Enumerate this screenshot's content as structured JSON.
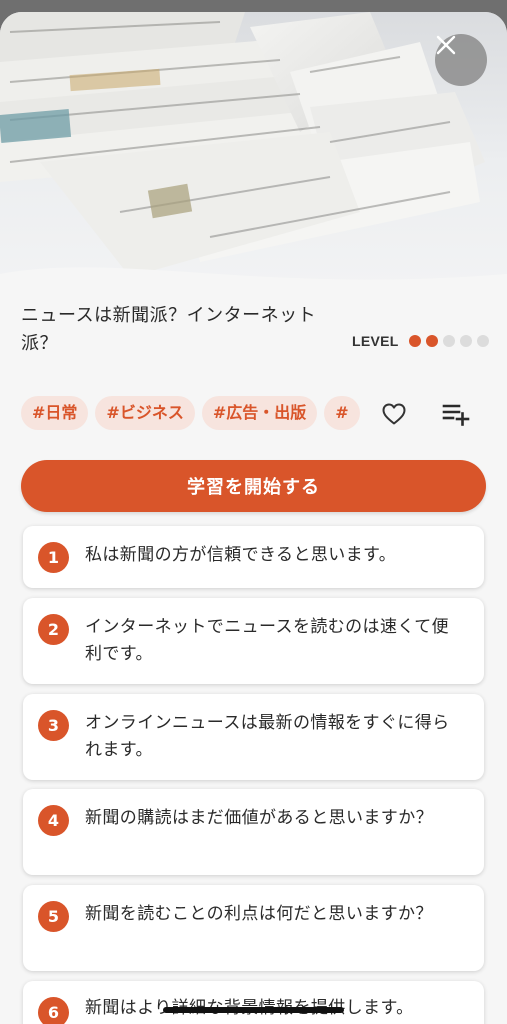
{
  "close_icon": "close-icon",
  "header": {
    "title": "ニュースは新聞派？インターネット派？",
    "level_label": "LEVEL",
    "level": {
      "value": 2,
      "max": 5
    },
    "accent_color": "#d9552a"
  },
  "tags": [
    "#日常",
    "#ビジネス",
    "#広告・出版",
    "#"
  ],
  "actions": {
    "favorite_icon": "heart-icon",
    "add_to_list_icon": "playlist-add-icon"
  },
  "start_button": {
    "label": "学習を開始する"
  },
  "sentences": [
    {
      "num": "1",
      "text": "私は新聞の方が信頼できると思います。"
    },
    {
      "num": "2",
      "text": "インターネットでニュースを読むのは速くて便利です。"
    },
    {
      "num": "3",
      "text": "オンラインニュースは最新の情報をすぐに得られます。"
    },
    {
      "num": "4",
      "text": "新聞の購読はまだ価値があると思いますか？"
    },
    {
      "num": "5",
      "text": "新聞を読むことの利点は何だと思いますか？"
    },
    {
      "num": "6",
      "text": "新聞はより詳細な背景情報を提供します。"
    }
  ]
}
